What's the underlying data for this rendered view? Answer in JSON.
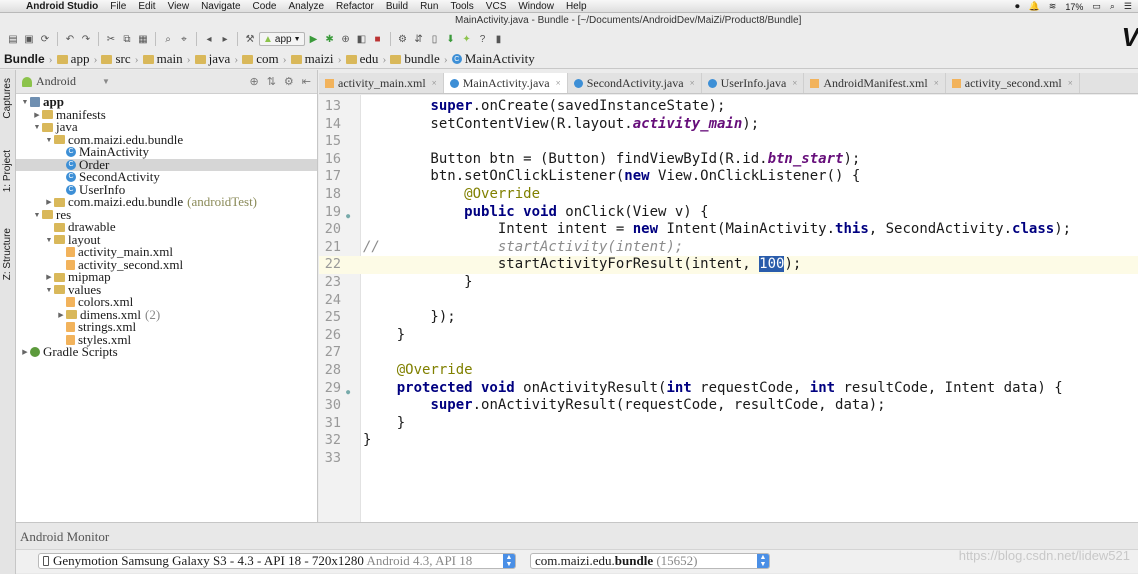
{
  "menubar": {
    "app_name": "Android Studio",
    "items": [
      "File",
      "Edit",
      "View",
      "Navigate",
      "Code",
      "Analyze",
      "Refactor",
      "Build",
      "Run",
      "Tools",
      "VCS",
      "Window",
      "Help"
    ],
    "battery": "17%"
  },
  "window_title": "MainActivity.java - Bundle - [~/Documents/AndroidDev/MaiZi/Product8/Bundle]",
  "toolbar": {
    "run_config": "app",
    "logo": "V"
  },
  "breadcrumb": [
    "Bundle",
    "app",
    "src",
    "main",
    "java",
    "com",
    "maizi",
    "edu",
    "bundle",
    "MainActivity"
  ],
  "side_tabs": [
    "Captures",
    "1: Project",
    "Z: Structure"
  ],
  "project": {
    "view_mode": "Android",
    "tree": [
      {
        "label": "app",
        "depth": 0,
        "icon": "app",
        "arrow": "down",
        "bold": true
      },
      {
        "label": "manifests",
        "depth": 1,
        "icon": "folder",
        "arrow": "right"
      },
      {
        "label": "java",
        "depth": 1,
        "icon": "folder",
        "arrow": "down"
      },
      {
        "label": "com.maizi.edu.bundle",
        "depth": 2,
        "icon": "folder",
        "arrow": "down"
      },
      {
        "label": "MainActivity",
        "depth": 3,
        "icon": "cls",
        "arrow": ""
      },
      {
        "label": "Order",
        "depth": 3,
        "icon": "cls",
        "arrow": "",
        "selected": true
      },
      {
        "label": "SecondActivity",
        "depth": 3,
        "icon": "cls",
        "arrow": ""
      },
      {
        "label": "UserInfo",
        "depth": 3,
        "icon": "cls",
        "arrow": ""
      },
      {
        "label": "com.maizi.edu.bundle",
        "depth": 2,
        "icon": "folder",
        "arrow": "right",
        "suffix": "(androidTest)"
      },
      {
        "label": "res",
        "depth": 1,
        "icon": "folder",
        "arrow": "down"
      },
      {
        "label": "drawable",
        "depth": 2,
        "icon": "folder",
        "arrow": ""
      },
      {
        "label": "layout",
        "depth": 2,
        "icon": "folder",
        "arrow": "down"
      },
      {
        "label": "activity_main.xml",
        "depth": 3,
        "icon": "xml",
        "arrow": ""
      },
      {
        "label": "activity_second.xml",
        "depth": 3,
        "icon": "xml",
        "arrow": ""
      },
      {
        "label": "mipmap",
        "depth": 2,
        "icon": "folder",
        "arrow": "right"
      },
      {
        "label": "values",
        "depth": 2,
        "icon": "folder",
        "arrow": "down"
      },
      {
        "label": "colors.xml",
        "depth": 3,
        "icon": "xml",
        "arrow": ""
      },
      {
        "label": "dimens.xml",
        "depth": 3,
        "icon": "folder",
        "arrow": "right",
        "suffix": "(2)"
      },
      {
        "label": "strings.xml",
        "depth": 3,
        "icon": "xml",
        "arrow": ""
      },
      {
        "label": "styles.xml",
        "depth": 3,
        "icon": "xml",
        "arrow": ""
      },
      {
        "label": "Gradle Scripts",
        "depth": 0,
        "icon": "gradle",
        "arrow": "right"
      }
    ]
  },
  "editor_tabs": [
    {
      "label": "activity_main.xml",
      "icon": "xml",
      "active": false
    },
    {
      "label": "MainActivity.java",
      "icon": "cls",
      "active": true
    },
    {
      "label": "SecondActivity.java",
      "icon": "cls",
      "active": false
    },
    {
      "label": "UserInfo.java",
      "icon": "cls",
      "active": false
    },
    {
      "label": "AndroidManifest.xml",
      "icon": "xml",
      "active": false
    },
    {
      "label": "activity_second.xml",
      "icon": "xml",
      "active": false
    }
  ],
  "code": {
    "lines": [
      {
        "n": "13",
        "html": "        <span class='kw'>super</span>.onCreate(savedInstanceState);"
      },
      {
        "n": "14",
        "html": "        setContentView(R.layout.<span class='field'>activity_main</span>);"
      },
      {
        "n": "15",
        "html": ""
      },
      {
        "n": "16",
        "html": "        Button btn = (Button) findViewById(R.id.<span class='field'>btn_start</span>);"
      },
      {
        "n": "17",
        "html": "        btn.setOnClickListener(<span class='kw'>new</span> View.OnClickListener() {"
      },
      {
        "n": "18",
        "html": "            <span class='ann'>@Override</span>"
      },
      {
        "n": "19",
        "html": "            <span class='kw'>public void</span> onClick(View v) {",
        "marker": true
      },
      {
        "n": "20",
        "html": "                Intent intent = <span class='kw'>new</span> Intent(MainActivity.<span class='kw'>this</span>, SecondActivity.<span class='kw'>class</span>);"
      },
      {
        "n": "21",
        "html": "<span class='cmt'>//              startActivity(intent);</span>"
      },
      {
        "n": "22",
        "html": "                startActivityForResult(intent, <span class='hl'>100</span>);",
        "current": true
      },
      {
        "n": "23",
        "html": "            }"
      },
      {
        "n": "24",
        "html": ""
      },
      {
        "n": "25",
        "html": "        });"
      },
      {
        "n": "26",
        "html": "    }"
      },
      {
        "n": "27",
        "html": ""
      },
      {
        "n": "28",
        "html": "    <span class='ann'>@Override</span>"
      },
      {
        "n": "29",
        "html": "    <span class='kw'>protected void</span> onActivityResult(<span class='kw'>int</span> requestCode, <span class='kw'>int</span> resultCode, Intent data) {",
        "marker": true
      },
      {
        "n": "30",
        "html": "        <span class='kw'>super</span>.onActivityResult(requestCode, resultCode, data);"
      },
      {
        "n": "31",
        "html": "    }"
      },
      {
        "n": "32",
        "html": "}"
      },
      {
        "n": "33",
        "html": ""
      }
    ]
  },
  "monitor": {
    "title": "Android Monitor",
    "device": "Genymotion Samsung Galaxy S3 - 4.3 - API 18 - 720x1280",
    "device_secondary": "Android 4.3, API 18",
    "process": "com.maizi.edu.",
    "process_bold": "bundle",
    "process_pid": "(15652)"
  },
  "watermark": "https://blog.csdn.net/lidew521",
  "colors": {
    "keyword": "#000080",
    "annotation": "#808000",
    "field": "#660e7a",
    "comment": "#8c8c8c",
    "selection": "#2a5cab",
    "current_line": "#fdfbe6"
  }
}
